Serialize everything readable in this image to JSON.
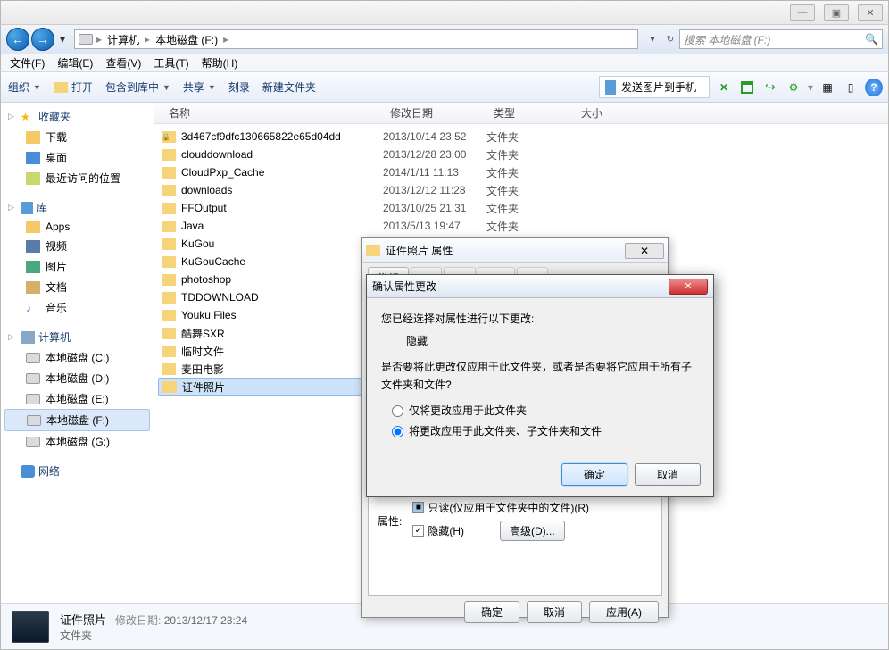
{
  "window_controls": {
    "min": "—",
    "max": "▣",
    "close": "✕"
  },
  "breadcrumb": {
    "computer": "计算机",
    "drive": "本地磁盘 (F:)"
  },
  "search": {
    "placeholder": "搜索 本地磁盘 (F:)"
  },
  "menu": {
    "file": "文件(F)",
    "edit": "编辑(E)",
    "view": "查看(V)",
    "tools": "工具(T)",
    "help": "帮助(H)"
  },
  "toolbar": {
    "organize": "组织",
    "open": "打开",
    "include": "包含到库中",
    "share": "共享",
    "burn": "刻录",
    "newfolder": "新建文件夹",
    "send": "发送图片到手机"
  },
  "sidebar": {
    "favorites": "收藏夹",
    "downloads": "下载",
    "desktop": "桌面",
    "recent": "最近访问的位置",
    "libraries": "库",
    "apps": "Apps",
    "videos": "视频",
    "pictures": "图片",
    "documents": "文档",
    "music": "音乐",
    "computer": "计算机",
    "drive_c": "本地磁盘 (C:)",
    "drive_d": "本地磁盘 (D:)",
    "drive_e": "本地磁盘 (E:)",
    "drive_f": "本地磁盘 (F:)",
    "drive_g": "本地磁盘 (G:)",
    "network": "网络"
  },
  "columns": {
    "name": "名称",
    "date": "修改日期",
    "type": "类型",
    "size": "大小"
  },
  "rows": [
    {
      "name": "3d467cf9dfc130665822e65d04dd",
      "date": "2013/10/14 23:52",
      "type": "文件夹",
      "locked": true
    },
    {
      "name": "clouddownload",
      "date": "2013/12/28 23:00",
      "type": "文件夹"
    },
    {
      "name": "CloudPxp_Cache",
      "date": "2014/1/11 11:13",
      "type": "文件夹"
    },
    {
      "name": "downloads",
      "date": "2013/12/12 11:28",
      "type": "文件夹"
    },
    {
      "name": "FFOutput",
      "date": "2013/10/25 21:31",
      "type": "文件夹"
    },
    {
      "name": "Java",
      "date": "2013/5/13 19:47",
      "type": "文件夹"
    },
    {
      "name": "KuGou",
      "date": "",
      "type": ""
    },
    {
      "name": "KuGouCache",
      "date": "",
      "type": ""
    },
    {
      "name": "photoshop",
      "date": "",
      "type": ""
    },
    {
      "name": "TDDOWNLOAD",
      "date": "",
      "type": ""
    },
    {
      "name": "Youku Files",
      "date": "",
      "type": ""
    },
    {
      "name": "酷舞SXR",
      "date": "",
      "type": ""
    },
    {
      "name": "临时文件",
      "date": "",
      "type": ""
    },
    {
      "name": "麦田电影",
      "date": "",
      "type": ""
    },
    {
      "name": "证件照片",
      "date": "",
      "type": "",
      "selected": true
    }
  ],
  "details": {
    "name": "证件照片",
    "date_label": "修改日期:",
    "date": "2013/12/17 23:24",
    "type": "文件夹"
  },
  "properties": {
    "title": "证件照片 属性",
    "tab_general": "常规",
    "attr_label": "属性:",
    "readonly": "只读(仅应用于文件夹中的文件)(R)",
    "hidden": "隐藏(H)",
    "advanced": "高级(D)...",
    "ok": "确定",
    "cancel": "取消",
    "apply": "应用(A)"
  },
  "confirm": {
    "title": "确认属性更改",
    "line1": "您已经选择对属性进行以下更改:",
    "change": "隐藏",
    "line2": "是否要将此更改仅应用于此文件夹，或者是否要将它应用于所有子文件夹和文件?",
    "opt1": "仅将更改应用于此文件夹",
    "opt2": "将更改应用于此文件夹、子文件夹和文件",
    "ok": "确定",
    "cancel": "取消"
  }
}
